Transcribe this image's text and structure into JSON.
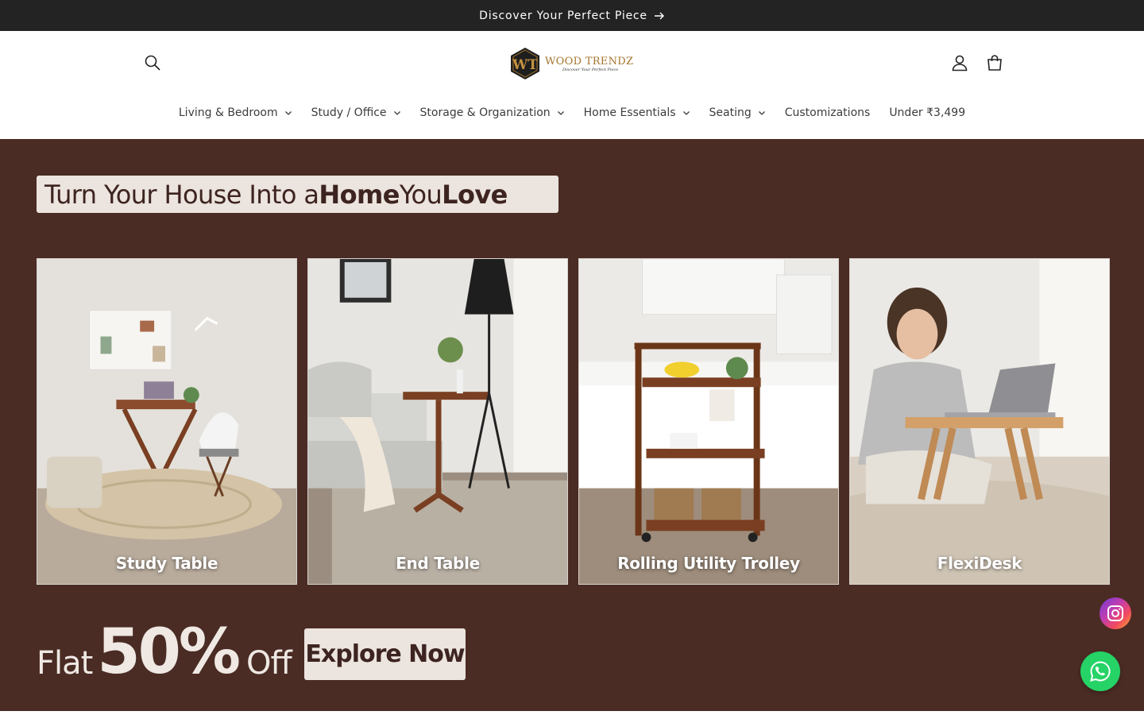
{
  "announcement": {
    "text": "Discover Your Perfect Piece",
    "icon": "arrow-right-icon"
  },
  "header": {
    "logo": {
      "mark": "WT",
      "name": "WOOD TRENDZ",
      "tagline": "Discover Your Perfect Piece"
    },
    "icons": [
      "search-icon",
      "account-icon",
      "cart-icon"
    ]
  },
  "nav": [
    {
      "label": "Living & Bedroom",
      "has_dropdown": true
    },
    {
      "label": "Study / Office",
      "has_dropdown": true
    },
    {
      "label": "Storage & Organization",
      "has_dropdown": true
    },
    {
      "label": "Home Essentials",
      "has_dropdown": true
    },
    {
      "label": "Seating",
      "has_dropdown": true
    },
    {
      "label": "Customizations",
      "has_dropdown": false
    },
    {
      "label": "Under ₹3,499",
      "has_dropdown": false
    }
  ],
  "hero": {
    "headline": {
      "part1": "Turn Your House Into a ",
      "bold1": "Home",
      "part2": " You ",
      "bold2": "Love"
    },
    "cards": [
      {
        "label": "Study Table"
      },
      {
        "label": "End Table"
      },
      {
        "label": "Rolling Utility Trolley"
      },
      {
        "label": "FlexiDesk"
      }
    ],
    "offer": {
      "flat": "Flat",
      "percent": "50%",
      "off": "Off"
    },
    "cta": "Explore Now"
  },
  "floating": {
    "instagram": "instagram-icon",
    "whatsapp": "whatsapp-icon"
  },
  "colors": {
    "announce_bg": "#232323",
    "hero_bg": "#4a2c24",
    "accent": "#a5762e",
    "whatsapp": "#25d366"
  }
}
